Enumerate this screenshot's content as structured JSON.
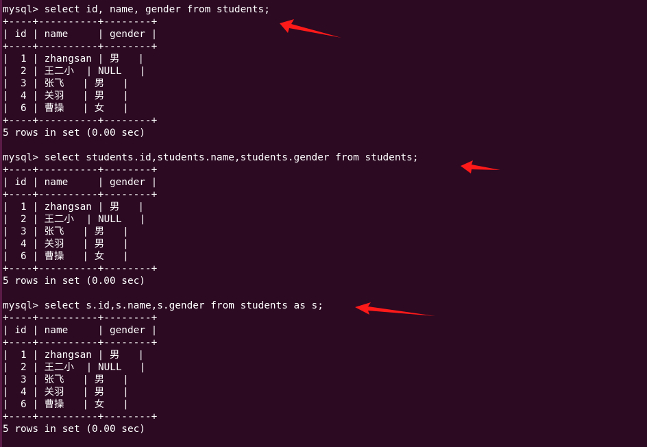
{
  "terminal": {
    "prompt": "mysql> ",
    "border": "+----+----------+--------+",
    "queries": [
      {
        "command": "select id, name, gender from students;",
        "header": "| id | name     | gender |",
        "rows": [
          {
            "id": "1",
            "name": "zhangsan",
            "gender": "男"
          },
          {
            "id": "2",
            "name": "王二小",
            "gender": "NULL"
          },
          {
            "id": "3",
            "name": "张飞",
            "gender": "男"
          },
          {
            "id": "4",
            "name": "关羽",
            "gender": "男"
          },
          {
            "id": "6",
            "name": "曹操",
            "gender": "女"
          }
        ],
        "status": "5 rows in set (0.00 sec)"
      },
      {
        "command": "select students.id,students.name,students.gender from students;",
        "header": "| id | name     | gender |",
        "rows": [
          {
            "id": "1",
            "name": "zhangsan",
            "gender": "男"
          },
          {
            "id": "2",
            "name": "王二小",
            "gender": "NULL"
          },
          {
            "id": "3",
            "name": "张飞",
            "gender": "男"
          },
          {
            "id": "4",
            "name": "关羽",
            "gender": "男"
          },
          {
            "id": "6",
            "name": "曹操",
            "gender": "女"
          }
        ],
        "status": "5 rows in set (0.00 sec)"
      },
      {
        "command": "select s.id,s.name,s.gender from students as s;",
        "header": "| id | name     | gender |",
        "rows": [
          {
            "id": "1",
            "name": "zhangsan",
            "gender": "男"
          },
          {
            "id": "2",
            "name": "王二小",
            "gender": "NULL"
          },
          {
            "id": "3",
            "name": "张飞",
            "gender": "男"
          },
          {
            "id": "4",
            "name": "关羽",
            "gender": "男"
          },
          {
            "id": "6",
            "name": "曹操",
            "gender": "女"
          }
        ],
        "status": "5 rows in set (0.00 sec)"
      }
    ]
  },
  "annotations": {
    "arrow_color": "#ff1a1a",
    "arrow_icon": "red-arrow-pointer"
  },
  "colors": {
    "background": "#2c0a22",
    "text": "#ffffff"
  }
}
